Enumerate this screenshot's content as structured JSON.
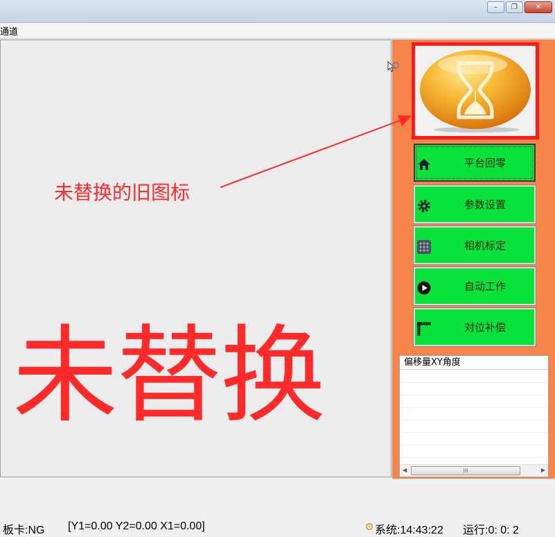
{
  "menubar": {
    "item": "通道"
  },
  "annotations": {
    "arrow_note": "未替换的旧图标",
    "big_note": "未替换",
    "color": "#ff2a2a"
  },
  "logo": {
    "icon": "hourglass-icon"
  },
  "buttons": [
    {
      "label": "平台回零",
      "icon": "home-icon"
    },
    {
      "label": "参数设置",
      "icon": "gear-icon"
    },
    {
      "label": "相机标定",
      "icon": "keypad-icon"
    },
    {
      "label": "自动工作",
      "icon": "play-icon"
    },
    {
      "label": "对位补偿",
      "icon": "ruler-icon"
    }
  ],
  "listview": {
    "header": "偏移量XY角度",
    "scroll_thumb": "III"
  },
  "status": {
    "board": "板卡:NG",
    "coords": "[Y1=0.00 Y2=0.00 X1=0.00]",
    "system_time": "系统:14:43:22",
    "run_time": "运行:0: 0: 2"
  },
  "colors": {
    "panel": "#f7854a",
    "button": "#08e23a",
    "logo_border": "#ff1a1a"
  }
}
